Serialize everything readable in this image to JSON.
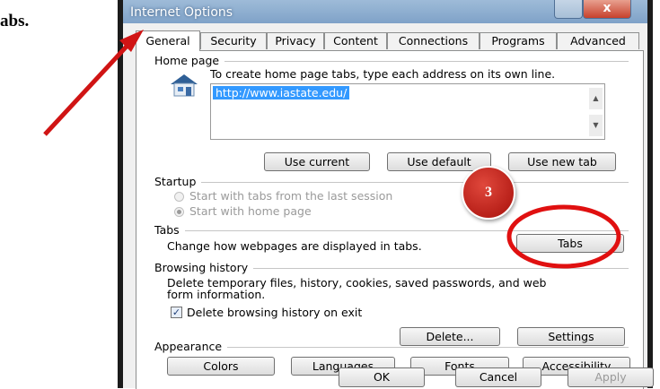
{
  "caption": {
    "text": "abs."
  },
  "window": {
    "title": "Internet Options",
    "close_glyph": "x"
  },
  "tabs": [
    {
      "label": "General"
    },
    {
      "label": "Security"
    },
    {
      "label": "Privacy"
    },
    {
      "label": "Content"
    },
    {
      "label": "Connections"
    },
    {
      "label": "Programs"
    },
    {
      "label": "Advanced"
    }
  ],
  "home_page": {
    "label": "Home page",
    "instruction": "To create home page tabs, type each address on its own line.",
    "url": "http://www.iastate.edu/",
    "icon": "house-icon",
    "buttons": {
      "use_current": "Use current",
      "use_default": "Use default",
      "use_new_tab": "Use new tab"
    }
  },
  "startup": {
    "label": "Startup",
    "option_last_session": "Start with tabs from the last session",
    "option_home_page": "Start with home page",
    "selected": "home_page"
  },
  "tabs_group": {
    "label": "Tabs",
    "description": "Change how webpages are displayed in tabs.",
    "button": "Tabs"
  },
  "browsing_history": {
    "label": "Browsing history",
    "description_line1": "Delete temporary files, history, cookies, saved passwords, and web",
    "description_line2": "form information.",
    "delete_on_exit": "Delete browsing history on exit",
    "delete_on_exit_checked": true,
    "buttons": {
      "delete": "Delete...",
      "settings": "Settings"
    }
  },
  "appearance": {
    "label": "Appearance",
    "buttons": {
      "colors": "Colors",
      "languages": "Languages",
      "fonts": "Fonts",
      "accessibility": "Accessibility"
    }
  },
  "footer": {
    "ok": "OK",
    "cancel": "Cancel",
    "apply": "Apply"
  },
  "annotation": {
    "step_number": "3",
    "arrow_color": "#d01414",
    "circle_color": "#e01010"
  }
}
